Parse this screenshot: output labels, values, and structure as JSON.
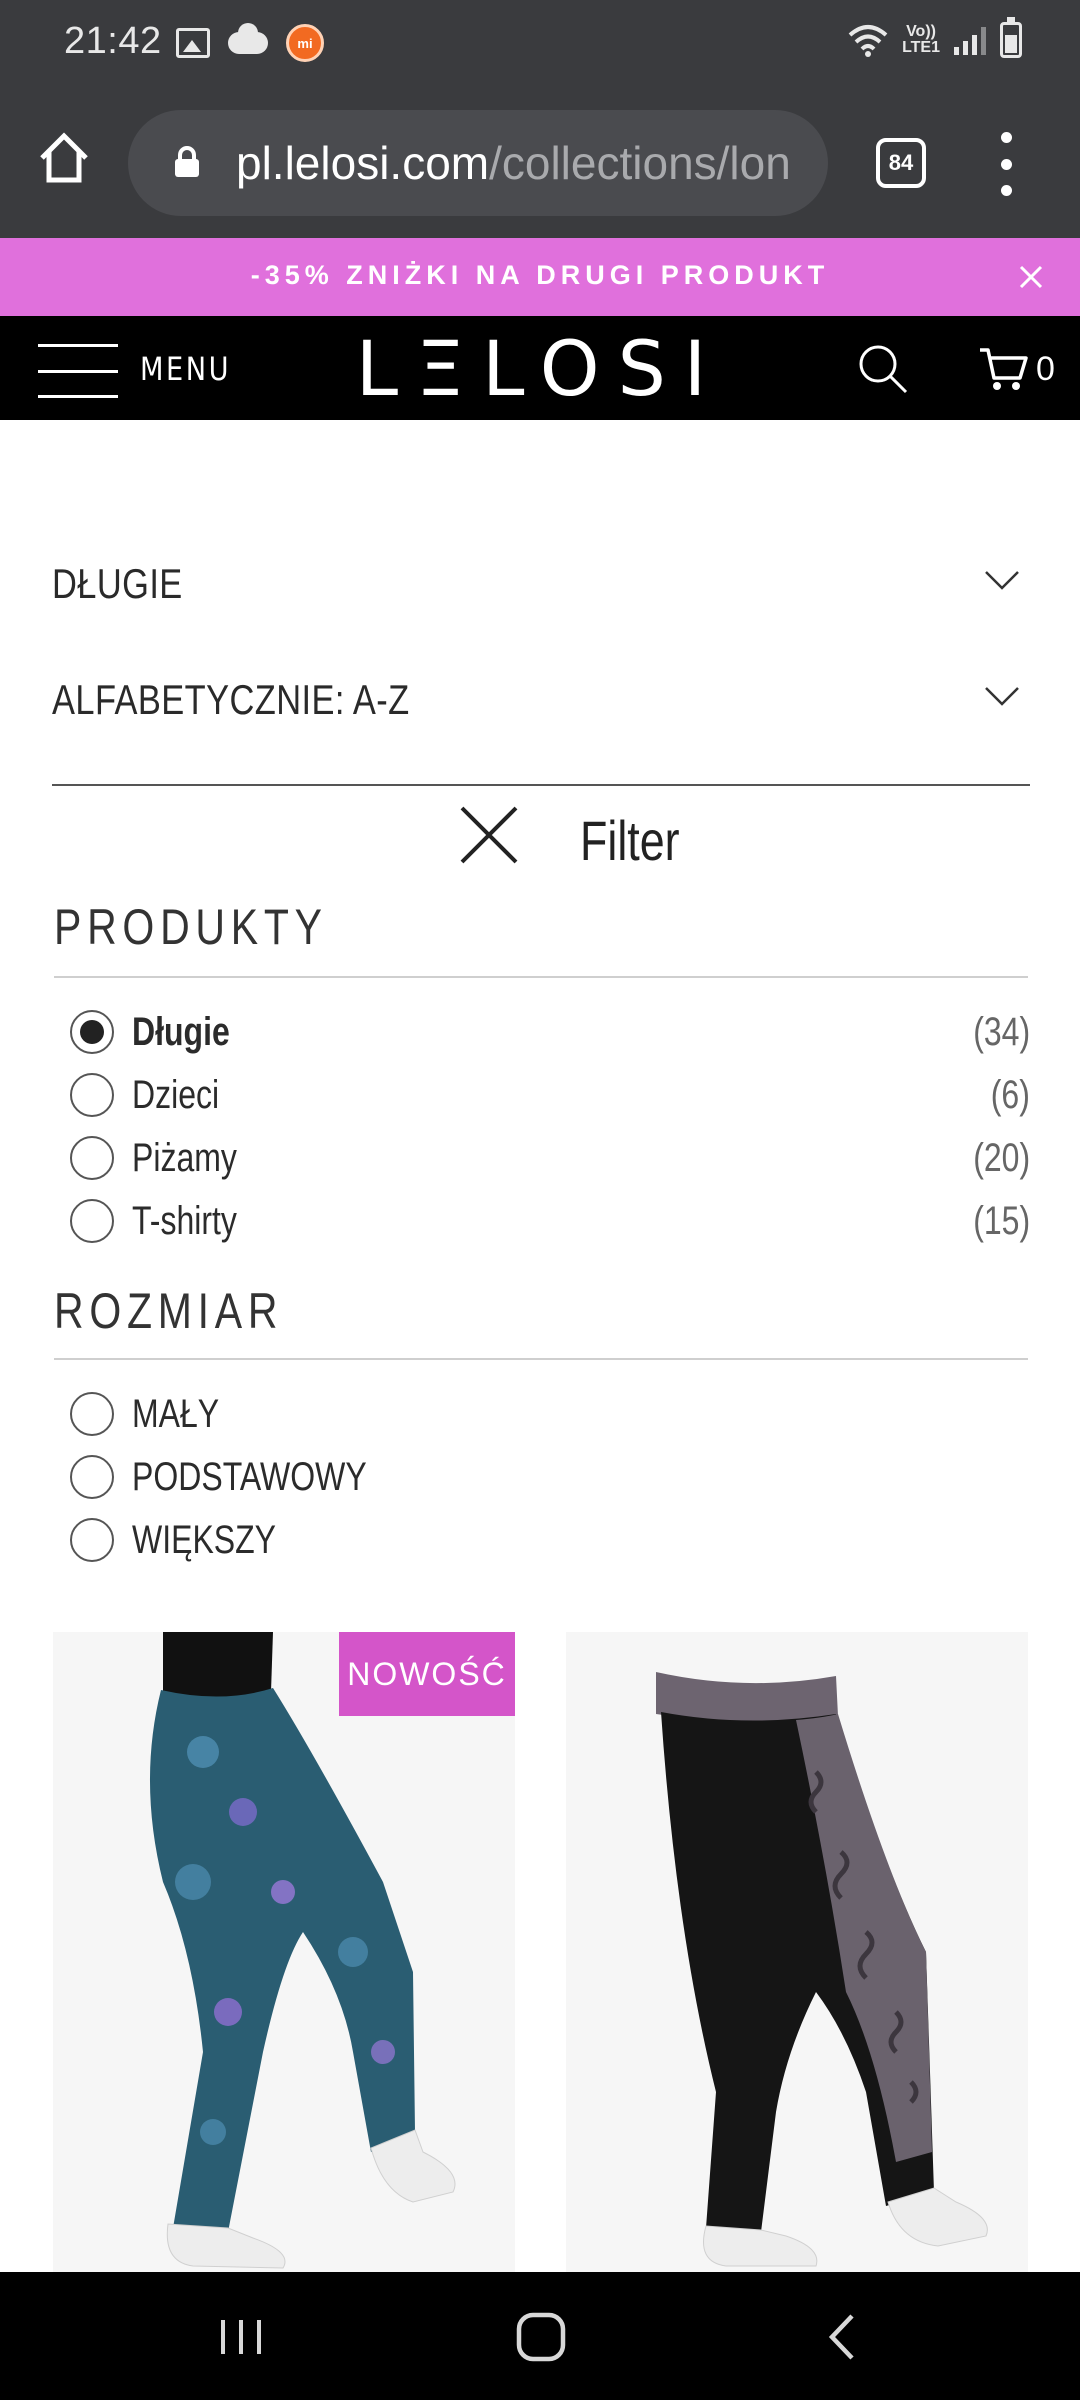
{
  "status_bar": {
    "time": "21:42",
    "volte_top": "Vo))",
    "volte_bottom": "LTE1",
    "icons": [
      "gallery-icon",
      "cloud-icon",
      "mi-icon",
      "wifi-icon",
      "volte-icon",
      "signal-icon",
      "battery-icon"
    ]
  },
  "browser": {
    "url_domain": "pl.lelosi.com",
    "url_path": "/collections/lon",
    "tab_count": "84",
    "icons": [
      "home-icon",
      "lock-icon",
      "more-vert-icon"
    ]
  },
  "promo": {
    "text": "-35% ZNIŻKI NA DRUGI PRODUKT",
    "background": "#e070dc"
  },
  "header": {
    "menu_label": "MENU",
    "logo": "LΞLOSI",
    "cart_count": "0",
    "icons": [
      "hamburger-icon",
      "search-icon",
      "cart-icon"
    ]
  },
  "collection_select": {
    "label": "DŁUGIE"
  },
  "sort_select": {
    "label": "ALFABETYCZNIE: A-Z"
  },
  "filter": {
    "title": "Filter",
    "products_heading": "PRODUKTY",
    "products": [
      {
        "label": "Długie",
        "count": "(34)",
        "selected": true
      },
      {
        "label": "Dzieci",
        "count": "(6)",
        "selected": false
      },
      {
        "label": "Piżamy",
        "count": "(20)",
        "selected": false
      },
      {
        "label": "T-shirty",
        "count": "(15)",
        "selected": false
      }
    ],
    "size_heading": "ROZMIAR",
    "sizes": [
      {
        "label": "MAŁY",
        "selected": false
      },
      {
        "label": "PODSTAWOWY",
        "selected": false
      },
      {
        "label": "WIĘKSZY",
        "selected": false
      }
    ]
  },
  "products": [
    {
      "badge": "NOWOŚĆ",
      "image": "teal floral leggings"
    },
    {
      "badge": "",
      "image": "black leggings with grey paisley side panel"
    }
  ],
  "colors": {
    "accent": "#e070dc",
    "badge": "#d455c9",
    "header_bg": "#000000",
    "browser_bg": "#3a3b3e"
  }
}
